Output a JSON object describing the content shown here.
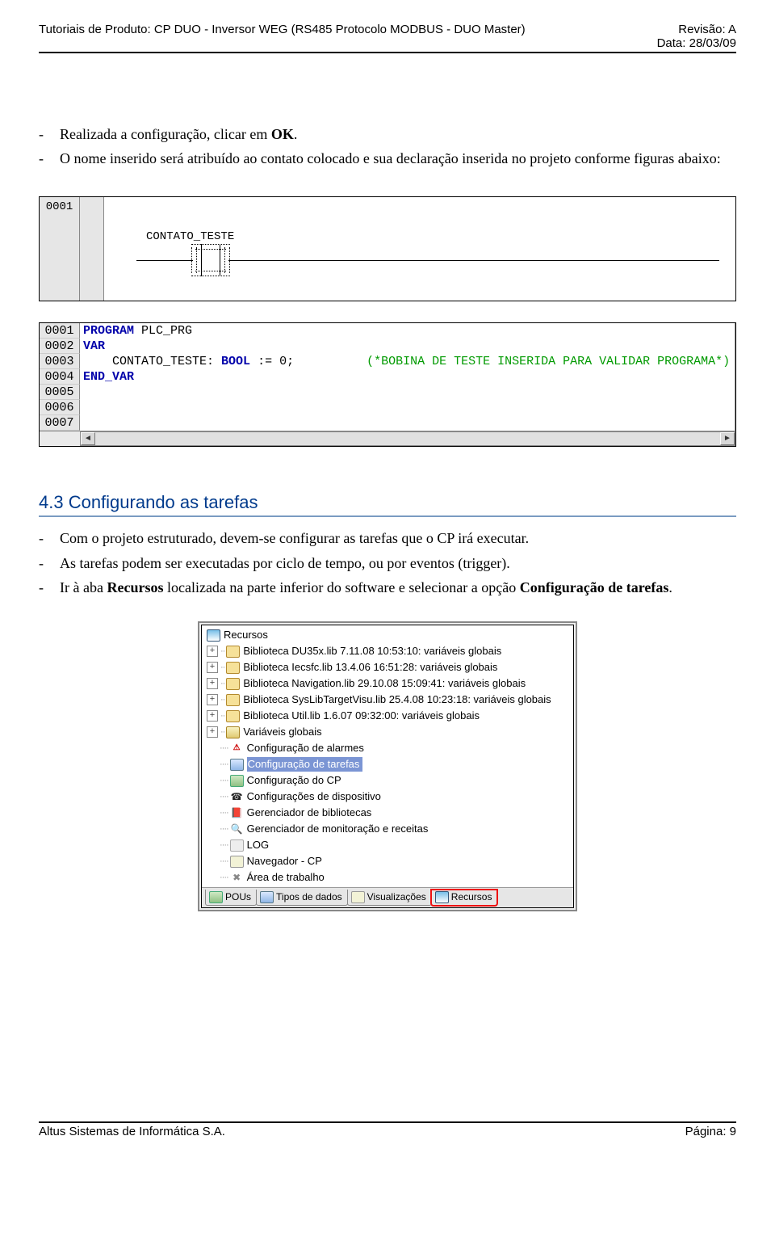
{
  "header": {
    "left": "Tutoriais de Produto: CP DUO - Inversor WEG (RS485 Protocolo MODBUS - DUO Master)",
    "right_line1": "Revisão: A",
    "right_line2": "Data: 28/03/09"
  },
  "bullets_top": [
    {
      "plain": "Realizada a configuração, clicar em ",
      "bold": "OK",
      "tail": "."
    },
    {
      "plain": "O nome inserido será atribuído ao contato colocado e sua declaração inserida no projeto conforme figuras abaixo:"
    }
  ],
  "ladder": {
    "line_no": "0001",
    "contact_label": "CONTATO_TESTE"
  },
  "code": {
    "lines": [
      {
        "n": "0001",
        "kw1": "PROGRAM",
        "rest": " PLC_PRG"
      },
      {
        "n": "0002",
        "kw1": "VAR"
      },
      {
        "n": "0003",
        "indent": "    ",
        "text": "CONTATO_TESTE: ",
        "type": "BOOL",
        "after": " := 0;          ",
        "comment": "(*BOBINA DE TESTE INSERIDA PARA VALIDAR PROGRAMA*)"
      },
      {
        "n": "0004",
        "kw1": "END_VAR"
      },
      {
        "n": "0005"
      },
      {
        "n": "0006"
      },
      {
        "n": "0007"
      }
    ]
  },
  "section_title": "4.3  Configurando as tarefas",
  "bullets_mid": [
    {
      "text": "Com o projeto estruturado, devem-se configurar as tarefas que o CP irá executar."
    },
    {
      "text": "As tarefas podem ser executadas por ciclo de tempo, ou por eventos (trigger)."
    },
    {
      "pre": "Ir à aba ",
      "b1": "Recursos",
      "mid": " localizada na parte inferior do software e selecionar a opção ",
      "b2": "Configuração de tarefas",
      "post": "."
    }
  ],
  "tree": {
    "root": "Recursos",
    "items": [
      {
        "expand": "+",
        "label": "Biblioteca DU35x.lib 7.11.08 10:53:10: variáveis globais",
        "icon": "folder"
      },
      {
        "expand": "+",
        "label": "Biblioteca Iecsfc.lib 13.4.06 16:51:28: variáveis globais",
        "icon": "folder"
      },
      {
        "expand": "+",
        "label": "Biblioteca Navigation.lib 29.10.08 15:09:41: variáveis globais",
        "icon": "folder"
      },
      {
        "expand": "+",
        "label": "Biblioteca SysLibTargetVisu.lib 25.4.08 10:23:18: variáveis globais",
        "icon": "folder"
      },
      {
        "expand": "+",
        "label": "Biblioteca Util.lib 1.6.07 09:32:00: variáveis globais",
        "icon": "folder"
      },
      {
        "expand": "+",
        "label": "Variáveis globais",
        "icon": "vars"
      },
      {
        "leaf": true,
        "label": "Configuração de alarmes",
        "icon": "alarm",
        "glyph": "⚠"
      },
      {
        "leaf": true,
        "label": "Configuração de tarefas",
        "icon": "task",
        "selected": true
      },
      {
        "leaf": true,
        "label": "Configuração do CP",
        "icon": "cp"
      },
      {
        "leaf": true,
        "label": "Configurações de dispositivo",
        "icon": "dev",
        "glyph": "☎"
      },
      {
        "leaf": true,
        "label": "Gerenciador de bibliotecas",
        "icon": "lib",
        "glyph": "📕"
      },
      {
        "leaf": true,
        "label": "Gerenciador de monitoração e receitas",
        "icon": "monitor",
        "glyph": "🔍"
      },
      {
        "leaf": true,
        "label": "LOG",
        "icon": "log"
      },
      {
        "leaf": true,
        "label": "Navegador - CP",
        "icon": "nav"
      },
      {
        "leaf": true,
        "label": "Área de trabalho",
        "icon": "area",
        "glyph": "✖"
      }
    ],
    "tabs": [
      {
        "label": "POUs",
        "icon": "cp"
      },
      {
        "label": "Tipos de dados",
        "icon": "task"
      },
      {
        "label": "Visualizações",
        "icon": "nav"
      },
      {
        "label": "Recursos",
        "icon": "resources",
        "highlight": true
      }
    ]
  },
  "footer": {
    "left": "Altus Sistemas de Informática S.A.",
    "right": "Página: 9"
  }
}
